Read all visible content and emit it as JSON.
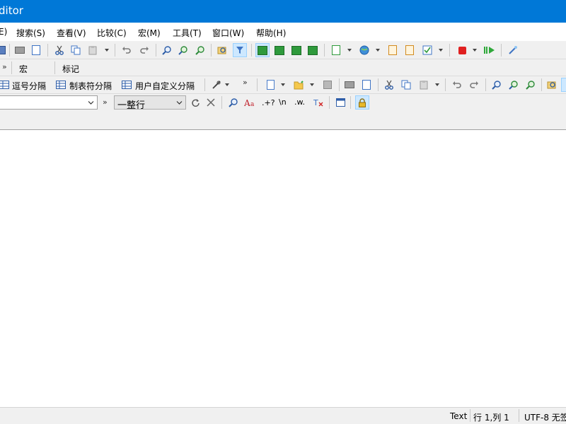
{
  "window": {
    "title": "ditor"
  },
  "menu": [
    "E)",
    "搜索(S)",
    "查看(V)",
    "比较(C)",
    "宏(M)",
    "工具(T)",
    "窗口(W)",
    "帮助(H)"
  ],
  "toolbar2": {
    "chevron": "»",
    "macro": "宏",
    "bookmark": "标记"
  },
  "toolbar3": {
    "tabs": [
      "逗号分隔",
      "制表符分隔",
      "用户自定义分隔"
    ],
    "chevron": "»"
  },
  "toolbar4": {
    "chevron": "»",
    "mode_value": "一整行",
    "regex_label": ".+?",
    "newline_label": "\\n",
    "whitespace_label": ".w."
  },
  "icons": {
    "toolbar1": [
      "save-icon",
      "print-icon",
      "print-preview-icon",
      "cut-icon",
      "copy-icon",
      "paste-icon",
      "undo-icon",
      "redo-icon",
      "find-icon",
      "find-next-icon",
      "find-previous-icon",
      "find-in-files-icon",
      "filter-icon",
      "view-mode-1-icon",
      "view-mode-2-icon",
      "view-mode-3-icon",
      "view-mode-4-icon",
      "spellcheck-icon",
      "globe-icon",
      "edit-document-icon",
      "edit-document-2-icon",
      "checklist-icon",
      "stop-record-icon",
      "play-macro-icon",
      "wand-icon"
    ],
    "toolbar3": [
      "table-icon",
      "tools-icon",
      "new-file-icon",
      "open-folder-icon",
      "save-icon",
      "print-icon",
      "print-preview-icon",
      "cut-icon",
      "copy-icon",
      "paste-icon",
      "undo-icon",
      "redo-icon",
      "find-icon",
      "find-next-icon",
      "find-previous-icon",
      "find-in-files-icon"
    ],
    "toolbar4": [
      "refresh-icon",
      "close-icon",
      "search-icon",
      "font-icon",
      "clear-format-icon",
      "window-icon",
      "lock-icon"
    ]
  },
  "status": {
    "mode": "Text",
    "position": "行 1,列 1",
    "encoding": "UTF-8 无签"
  },
  "colors": {
    "titlebar": "#0078d7",
    "toolbar": "#f0f0f0",
    "active_button": "#cde8ff"
  }
}
